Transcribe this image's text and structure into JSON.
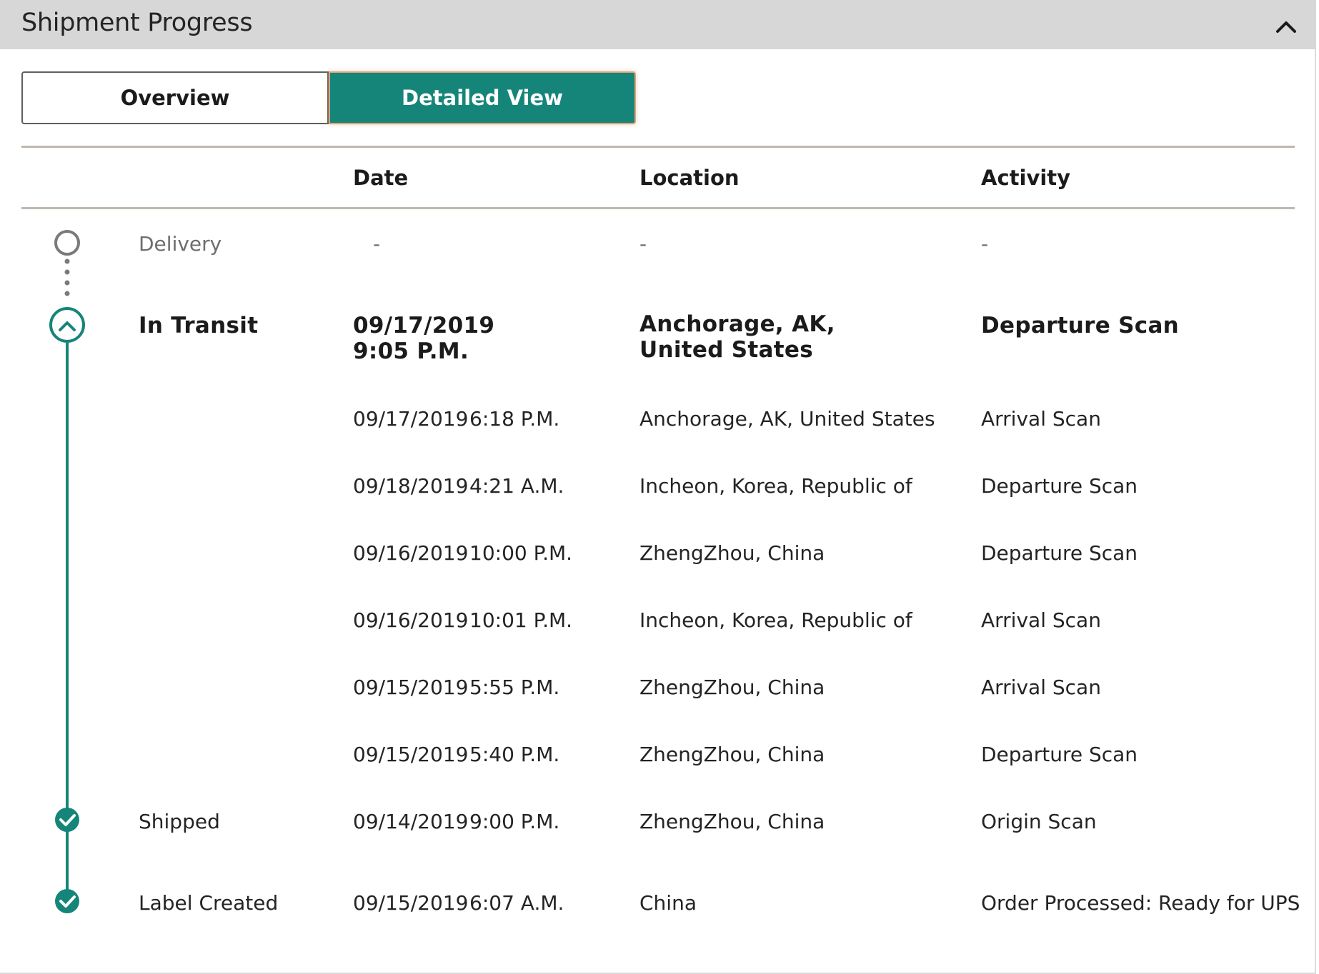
{
  "header": {
    "title": "Shipment Progress"
  },
  "icons": {
    "collapse": "chevron-up-icon",
    "in_transit": "chevron-up-circle-icon",
    "done": "check-circle-icon",
    "pending": "empty-circle-icon"
  },
  "tabs": [
    {
      "label": "Overview",
      "selected": false
    },
    {
      "label": "Detailed View",
      "selected": true
    }
  ],
  "columns": {
    "date": "Date",
    "location": "Location",
    "activity": "Activity"
  },
  "colors": {
    "accent": "#168579",
    "pending": "#7a7a7a",
    "rule": "#bfb8b0",
    "header_bg": "#d7d7d7"
  },
  "delivery": {
    "status": "Delivery",
    "date": "-",
    "location": "-",
    "activity": "-"
  },
  "in_transit": {
    "status": "In Transit",
    "date_line1": "09/17/2019",
    "date_line2": "9:05 P.M.",
    "location": "Anchorage, AK, United States",
    "activity": "Departure Scan"
  },
  "events": [
    {
      "date": "09/17/2019",
      "time": "6:18 P.M.",
      "location": "Anchorage, AK, United States",
      "activity": "Arrival Scan"
    },
    {
      "date": "09/18/2019",
      "time": "4:21 A.M.",
      "location": "Incheon, Korea, Republic of",
      "activity": "Departure Scan"
    },
    {
      "date": "09/16/2019",
      "time": "10:00 P.M.",
      "location": "ZhengZhou, China",
      "activity": "Departure Scan"
    },
    {
      "date": "09/16/2019",
      "time": "10:01 P.M.",
      "location": "Incheon, Korea, Republic of",
      "activity": "Arrival Scan"
    },
    {
      "date": "09/15/2019",
      "time": "5:55 P.M.",
      "location": "ZhengZhou, China",
      "activity": "Arrival Scan"
    },
    {
      "date": "09/15/2019",
      "time": "5:40 P.M.",
      "location": "ZhengZhou, China",
      "activity": "Departure Scan"
    }
  ],
  "shipped": {
    "status": "Shipped",
    "date": "09/14/2019",
    "time": "9:00 P.M.",
    "location": "ZhengZhou, China",
    "activity": "Origin Scan"
  },
  "label_created": {
    "status": "Label Created",
    "date": "09/15/2019",
    "time": "6:07 A.M.",
    "location": "China",
    "activity": "Order Processed: Ready for UPS"
  }
}
